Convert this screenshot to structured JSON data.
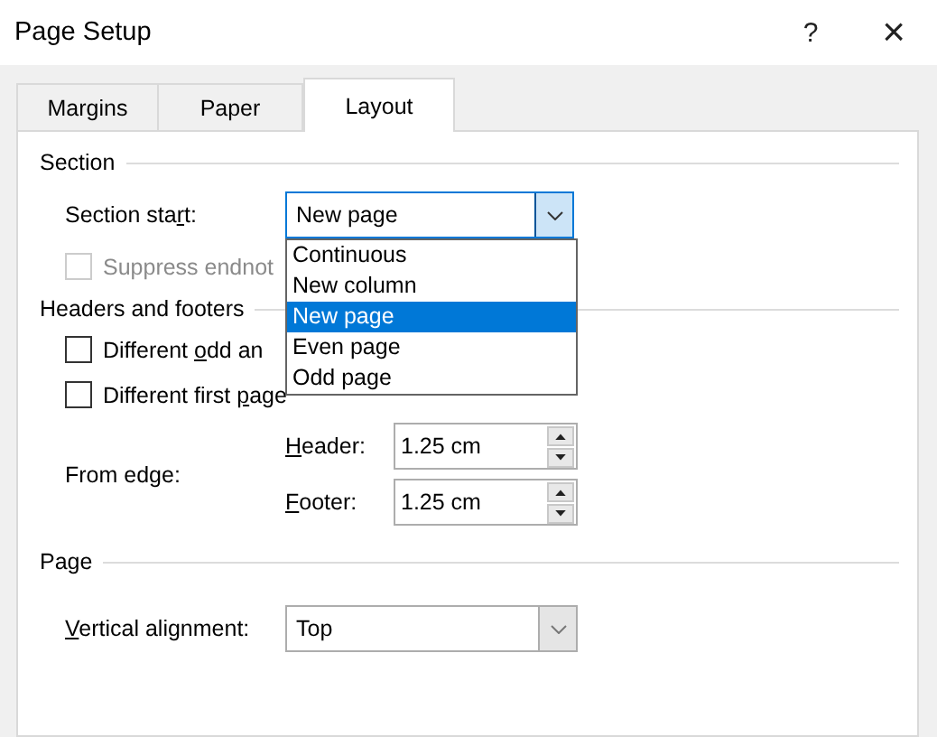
{
  "window": {
    "title": "Page Setup",
    "help": "?",
    "close": "×"
  },
  "tabs": [
    {
      "label": "Margins",
      "selected": false
    },
    {
      "label": "Paper",
      "selected": false
    },
    {
      "label": "Layout",
      "selected": true
    }
  ],
  "section": {
    "heading": "Section",
    "start_label": {
      "pre": "Section sta",
      "key": "r",
      "post": "t:"
    },
    "start_value": "New page",
    "dropdown_expanded": true,
    "options": [
      {
        "label": "Continuous",
        "selected": false
      },
      {
        "label": "New column",
        "selected": false
      },
      {
        "label": "New page",
        "selected": true
      },
      {
        "label": "Even page",
        "selected": false
      },
      {
        "label": "Odd page",
        "selected": false
      }
    ],
    "suppress": {
      "label": "Suppress endnot",
      "checked": false,
      "disabled": true
    }
  },
  "headers_footers": {
    "heading": "Headers and footers",
    "checkboxes": [
      {
        "label": {
          "pre": "Different ",
          "key": "o",
          "post": "dd an"
        },
        "checked": false
      },
      {
        "label": {
          "pre": "Different first ",
          "key": "p",
          "post": "age"
        },
        "checked": false
      }
    ],
    "from_edge_label": "From edge:",
    "spinners": [
      {
        "label": {
          "key": "H",
          "post": "eader:"
        },
        "value": "1.25 cm"
      },
      {
        "label": {
          "key": "F",
          "post": "ooter:"
        },
        "value": "1.25 cm"
      }
    ]
  },
  "page": {
    "heading": "Page",
    "alignment_label": {
      "key": "V",
      "post": "ertical alignment:"
    },
    "alignment_value": "Top"
  }
}
